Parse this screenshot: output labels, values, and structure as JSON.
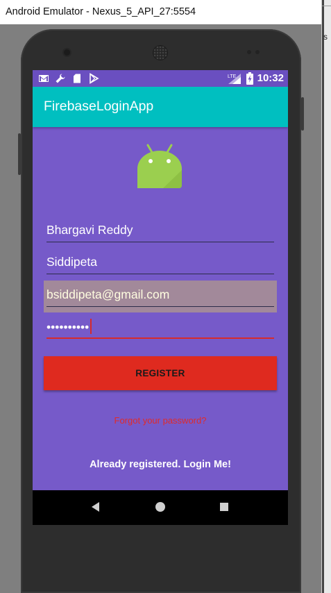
{
  "window": {
    "title": "Android Emulator - Nexus_5_API_27:5554",
    "side_letter": "s"
  },
  "status_bar": {
    "icons": [
      "gmail-icon",
      "wrench-icon",
      "sd-card-icon",
      "play-store-icon"
    ],
    "right_icons": [
      "lte-signal-icon",
      "battery-charging-icon"
    ],
    "network_label": "LTE",
    "time": "10:32",
    "color": "#6a4fc0"
  },
  "app_bar": {
    "title": "FirebaseLoginApp",
    "color": "#00bfc0"
  },
  "form": {
    "name_value": "Bhargavi Reddy",
    "surname_value": "Siddipeta",
    "email_value": "bsiddipeta@gmail.com",
    "password_value": "••••••••••",
    "register_label": "REGISTER",
    "forgot_label": "Forgot your password?",
    "login_label": "Already registered. Login Me!"
  },
  "colors": {
    "background": "#765ac9",
    "button": "#df2a1f",
    "link_red": "#e02a2a"
  },
  "nav_bar": {
    "icons": [
      "back-icon",
      "home-icon",
      "recents-icon"
    ]
  }
}
